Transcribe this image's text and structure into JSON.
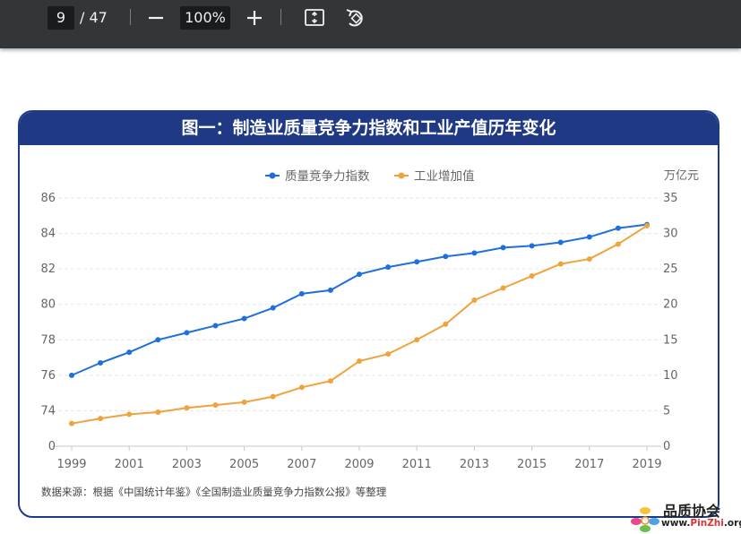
{
  "toolbar": {
    "page_current": "9",
    "page_total": "/ 47",
    "zoom": "100%",
    "zoom_out_icon": "minus-icon",
    "zoom_in_icon": "plus-icon",
    "fit_icon": "fit-page-icon",
    "rotate_icon": "rotate-icon"
  },
  "figure": {
    "title": "图一：制造业质量竞争力指数和工业产值历年变化",
    "source": "数据来源：根据《中国统计年鉴》《全国制造业质量竞争力指数公报》等整理",
    "right_unit": "万亿元"
  },
  "watermark": {
    "title": "品质协会",
    "url_prefix": "www.",
    "url_brand": "PinZhi",
    "url_suffix": ".org"
  },
  "chart_data": {
    "type": "line",
    "x": [
      1999,
      2000,
      2001,
      2002,
      2003,
      2004,
      2005,
      2006,
      2007,
      2008,
      2009,
      2010,
      2011,
      2012,
      2013,
      2014,
      2015,
      2016,
      2017,
      2018,
      2019
    ],
    "x_tick_labels": [
      "1999",
      "2001",
      "2003",
      "2005",
      "2007",
      "2009",
      "2011",
      "2013",
      "2015",
      "2017",
      "2019"
    ],
    "left_axis": {
      "ticks": [
        "0",
        "74",
        "76",
        "78",
        "80",
        "82",
        "84",
        "86"
      ],
      "note": "broken axis: bottom gridline labeled 0, then 74 to 86"
    },
    "right_axis": {
      "ticks": [
        "0",
        "5",
        "10",
        "15",
        "20",
        "25",
        "30",
        "35"
      ],
      "ylim": [
        0,
        35
      ],
      "unit": "万亿元"
    },
    "legend_position": "top-center",
    "grid": "horizontal dashed",
    "series": [
      {
        "name": "质量竞争力指数",
        "axis": "left",
        "color": "#1f6fdc",
        "values": [
          76.0,
          76.7,
          77.3,
          78.0,
          78.4,
          78.8,
          79.2,
          79.8,
          80.6,
          80.8,
          81.7,
          82.1,
          82.4,
          82.7,
          82.9,
          83.2,
          83.3,
          83.5,
          83.8,
          84.3,
          84.5
        ]
      },
      {
        "name": "工业增加值",
        "axis": "right",
        "color": "#f0a23c",
        "values": [
          3.2,
          3.9,
          4.5,
          4.8,
          5.4,
          5.8,
          6.2,
          7.0,
          8.3,
          9.2,
          12.0,
          13.0,
          15.0,
          17.2,
          20.6,
          22.3,
          24.0,
          25.7,
          26.4,
          28.5,
          31.1
        ]
      }
    ]
  }
}
